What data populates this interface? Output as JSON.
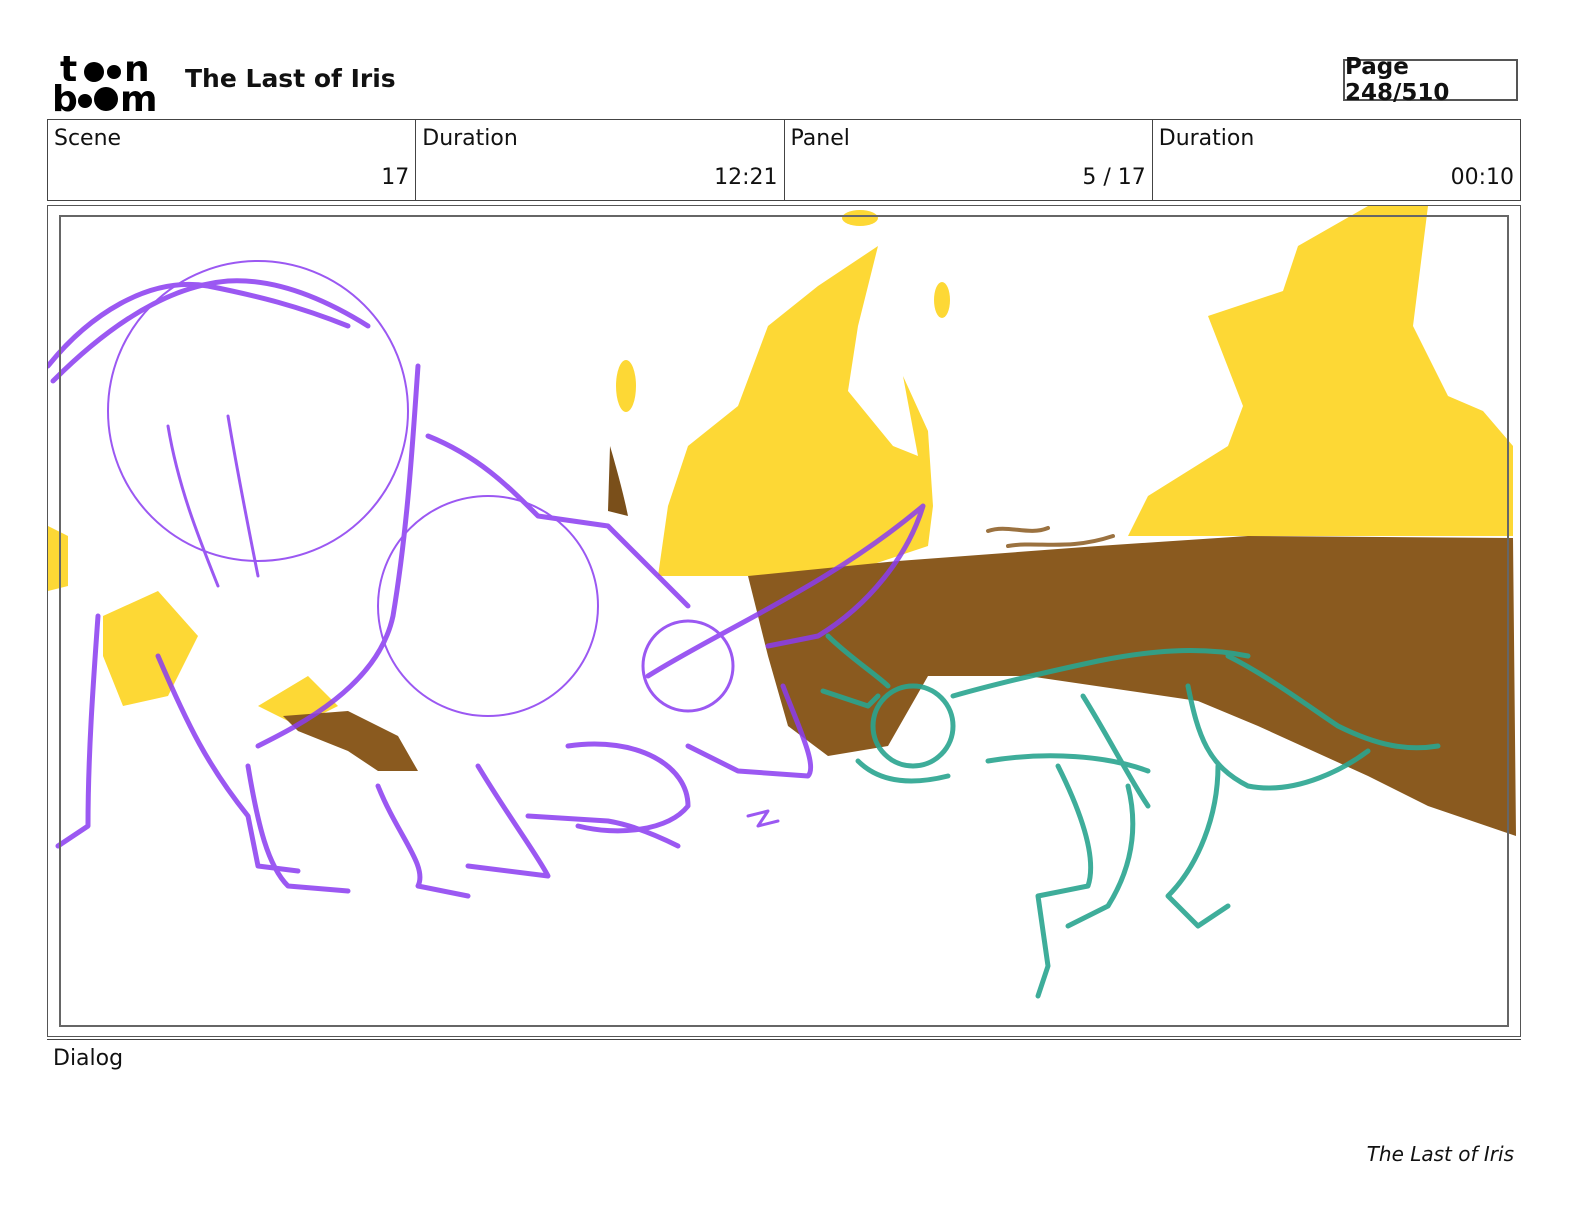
{
  "logo": {
    "line1": "to",
    "line1b": "n",
    "line2": "b",
    "line2b": "m"
  },
  "header": {
    "project_title": "The Last of Iris",
    "page_indicator": "Page 248/510"
  },
  "info": {
    "scene_label": "Scene",
    "scene_value": "17",
    "scene_duration_label": "Duration",
    "scene_duration_value": "12:21",
    "panel_label": "Panel",
    "panel_value": "5 / 17",
    "panel_duration_label": "Duration",
    "panel_duration_value": "00:10"
  },
  "dialog": {
    "label": "Dialog"
  },
  "footer": {
    "text": "The Last of Iris"
  },
  "colors": {
    "flame": "#fdd835",
    "ground": "#8a5a1f",
    "sketch_purple": "#8a3cf0",
    "sketch_teal": "#2aa590"
  }
}
